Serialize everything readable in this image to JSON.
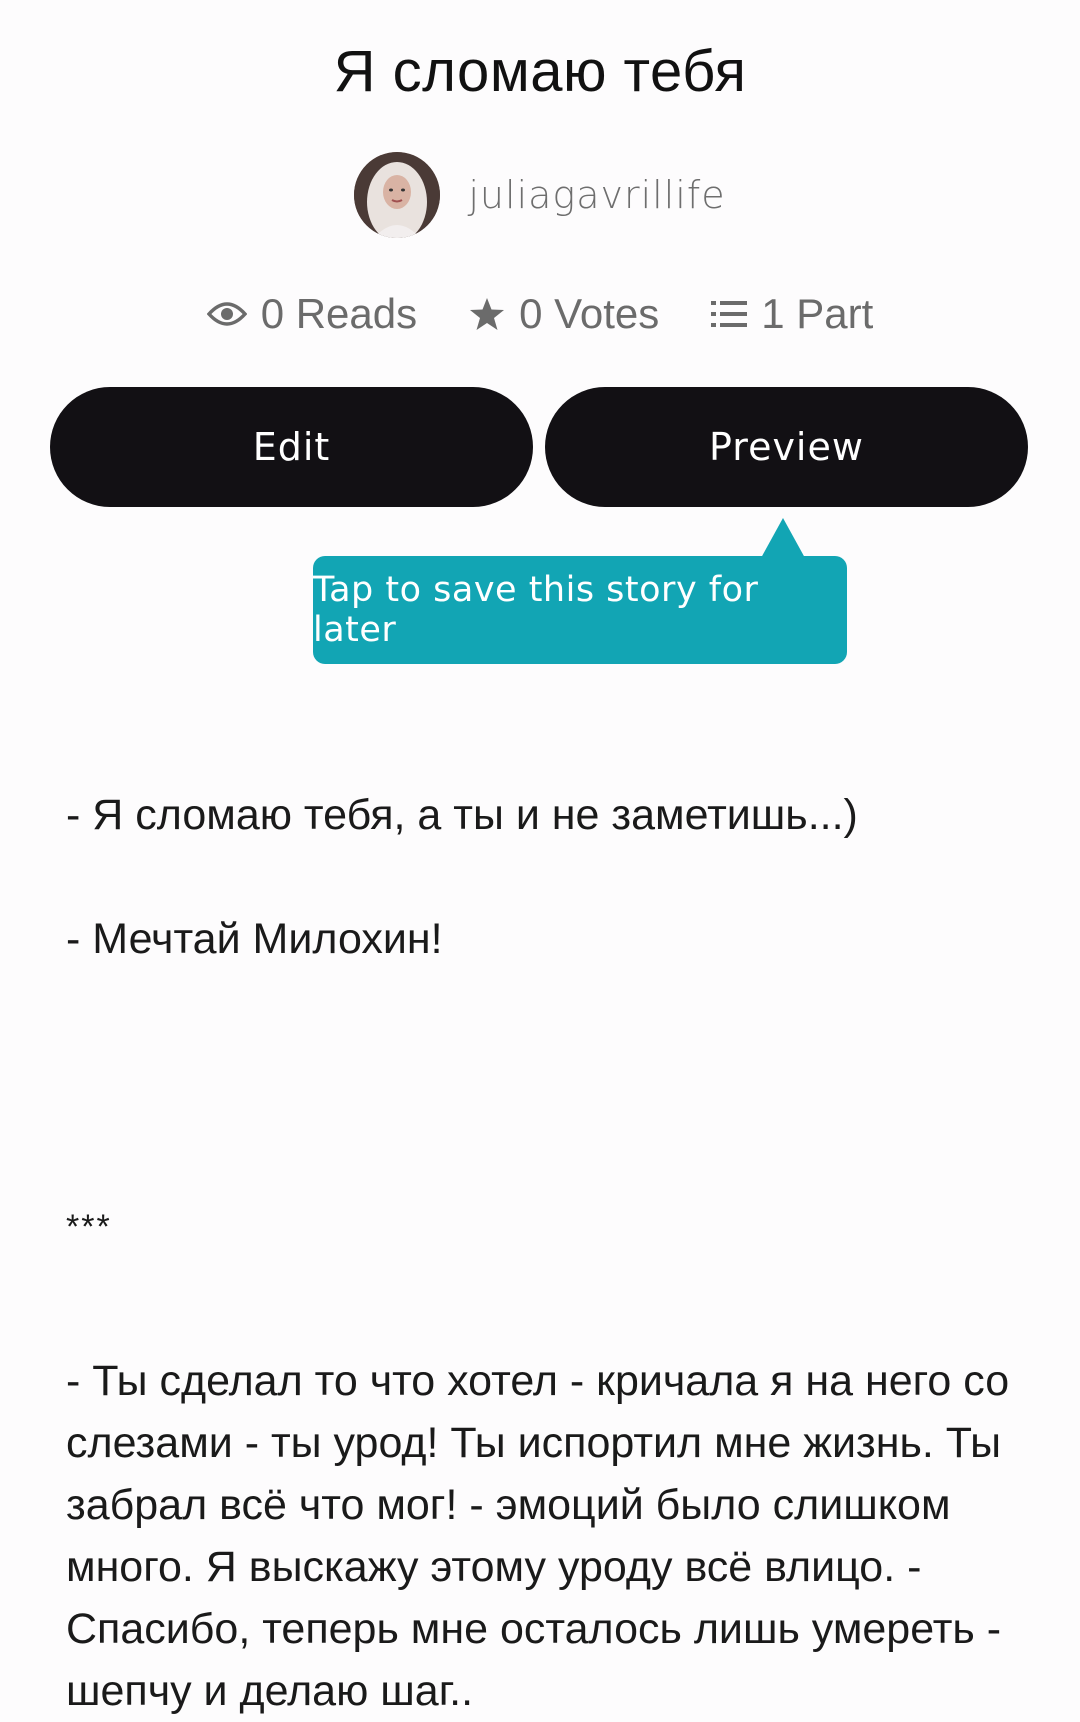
{
  "story": {
    "title": "Я сломаю тебя",
    "author": "juliagavrillife",
    "stats": {
      "reads": "0 Reads",
      "votes": "0 Votes",
      "parts": "1 Part"
    }
  },
  "actions": {
    "edit_label": "Edit",
    "preview_label": "Preview"
  },
  "tooltip": {
    "text": "Tap to save this story for later"
  },
  "content": {
    "line1": "- Я сломаю тебя, а ты и не заметишь...)",
    "line2": "- Мечтай Милохин!",
    "separator": "***",
    "paragraph": "- Ты сделал то что хотел - кричала я на него со слезами - ты урод! Ты испортил мне жизнь. Ты забрал всё что мог! - эмоций было слишком много. Я выскажу этому уроду всё влицо. - Спасибо, теперь мне осталось лишь умереть - шепчу и делаю шаг.."
  },
  "colors": {
    "button_bg": "#121014",
    "tooltip_bg": "#12a5b4",
    "stat_text": "#6b6b6b"
  },
  "icons": {
    "reads": "eye-icon",
    "votes": "star-icon",
    "parts": "list-icon"
  }
}
